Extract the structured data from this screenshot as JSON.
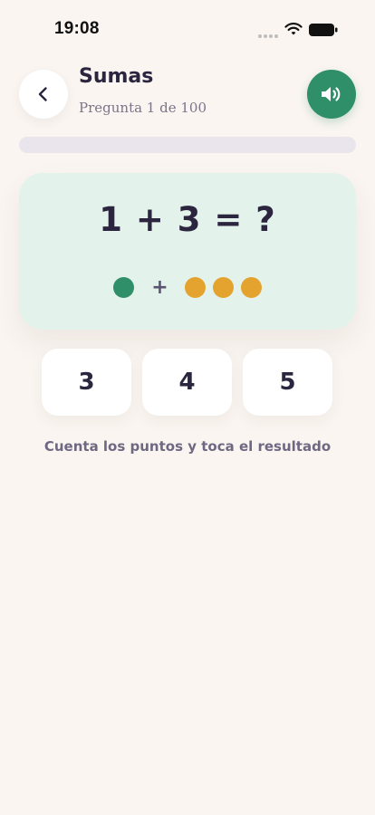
{
  "status_bar": {
    "time": "19:08"
  },
  "header": {
    "title": "Sumas",
    "subtitle": "Pregunta 1 de 100",
    "back_icon": "chevron-left-icon",
    "sound_icon": "speaker-icon"
  },
  "progress": {
    "value": 0.0
  },
  "question": {
    "equation": "1 + 3 = ?",
    "left_count": 1,
    "operator": "+",
    "right_count": 3
  },
  "answers": [
    "3",
    "4",
    "5"
  ],
  "hint": "Cuenta los puntos y toca el resultado",
  "colors": {
    "background": "#FAF5F1",
    "accent_green": "#2F8F68",
    "card_green": "#E3F2EA",
    "dot_orange": "#E3A32E",
    "text_dark": "#2B2540",
    "text_muted": "#7C7488"
  }
}
